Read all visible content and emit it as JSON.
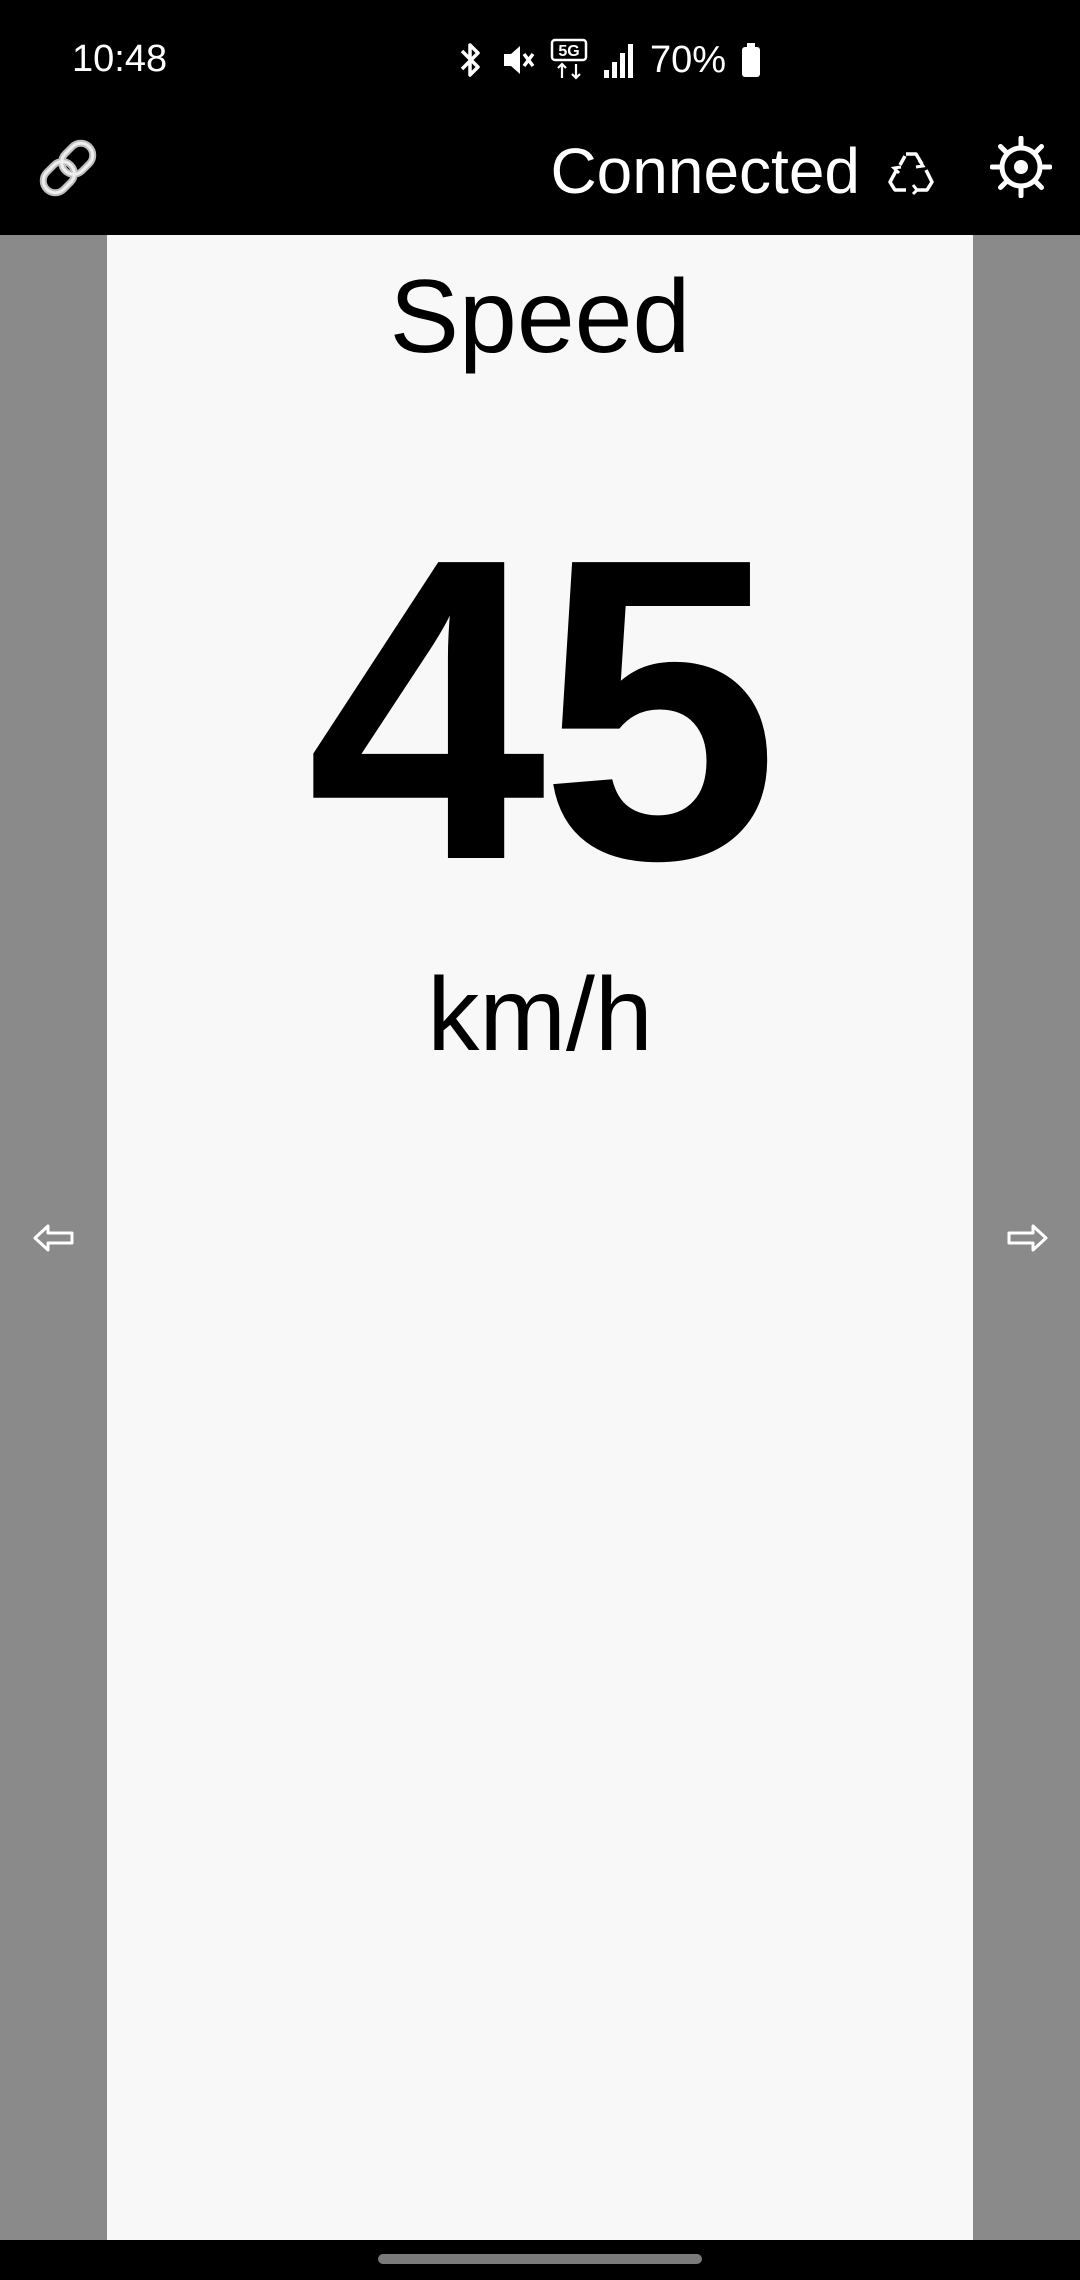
{
  "status_bar": {
    "time": "10:48",
    "battery": "70%",
    "network_badge": "5G",
    "icons": [
      "bluetooth-icon",
      "mute-icon",
      "5g-icon",
      "signal-icon",
      "battery-icon"
    ]
  },
  "app_bar": {
    "connection_status": "Connected",
    "icons": [
      "link-icon",
      "recycle-icon",
      "settings-icon"
    ]
  },
  "metric": {
    "title": "Speed",
    "value": "45",
    "unit": "km/h"
  },
  "nav": {
    "prev_symbol": "⇦",
    "next_symbol": "⇨"
  },
  "colors": {
    "bar_background": "#000000",
    "side_gutter": "#8a8a8a",
    "panel_background": "#f8f8f8",
    "text": "#000000"
  }
}
